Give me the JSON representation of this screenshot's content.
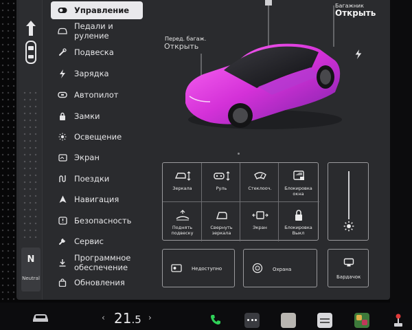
{
  "menu": {
    "items": [
      {
        "label": "Управление",
        "icon": "toggle-icon",
        "active": true
      },
      {
        "label": "Педали и руление",
        "icon": "car-icon"
      },
      {
        "label": "Подвеска",
        "icon": "wrench-icon"
      },
      {
        "label": "Зарядка",
        "icon": "bolt-icon"
      },
      {
        "label": "Автопилот",
        "icon": "steering-wheel-icon"
      },
      {
        "label": "Замки",
        "icon": "lock-icon"
      },
      {
        "label": "Освещение",
        "icon": "sun-icon"
      },
      {
        "label": "Экран",
        "icon": "display-icon"
      },
      {
        "label": "Поездки",
        "icon": "trips-icon"
      },
      {
        "label": "Навигация",
        "icon": "navigation-icon"
      },
      {
        "label": "Безопасность",
        "icon": "shield-icon"
      },
      {
        "label": "Сервис",
        "icon": "wrench-icon"
      },
      {
        "label_line1": "Программное",
        "label_line2": "обеспечение",
        "icon": "download-icon"
      },
      {
        "label": "Обновления",
        "icon": "bag-icon"
      }
    ]
  },
  "car": {
    "front_trunk_label": "Перед. багаж.",
    "front_trunk_action": "Открыть",
    "rear_trunk_label": "Багажник",
    "rear_trunk_action": "Открыть",
    "body_color": "#e040e8"
  },
  "gear": {
    "letter": "N",
    "word": "Neutral"
  },
  "controls": {
    "cells": [
      {
        "label": "Зеркала",
        "icon": "mirror-adjust-icon"
      },
      {
        "label": "Руль",
        "icon": "steering-adjust-icon"
      },
      {
        "label": "Стеклооч.",
        "icon": "wiper-icon"
      },
      {
        "label": "Блокировка окна",
        "icon": "window-lock-icon"
      },
      {
        "label": "Поднять подвеску",
        "icon": "suspension-icon"
      },
      {
        "label": "Свернуть зеркала",
        "icon": "mirror-fold-icon"
      },
      {
        "label": "Экран",
        "icon": "screen-icon"
      },
      {
        "label": "Блокировка Выкл",
        "icon": "child-lock-icon"
      }
    ],
    "unavailable_label": "Недоступно",
    "guard_label": "Охрана",
    "glovebox_label": "Бардачок"
  },
  "climate": {
    "temp_whole": "21",
    "temp_decimal": ".5",
    "left_chevron": "‹",
    "right_chevron": "›"
  },
  "colors": {
    "accent_pink": "#e040e8",
    "active_menu_bg": "#e9e9ec",
    "phone_green": "#2fd158"
  }
}
